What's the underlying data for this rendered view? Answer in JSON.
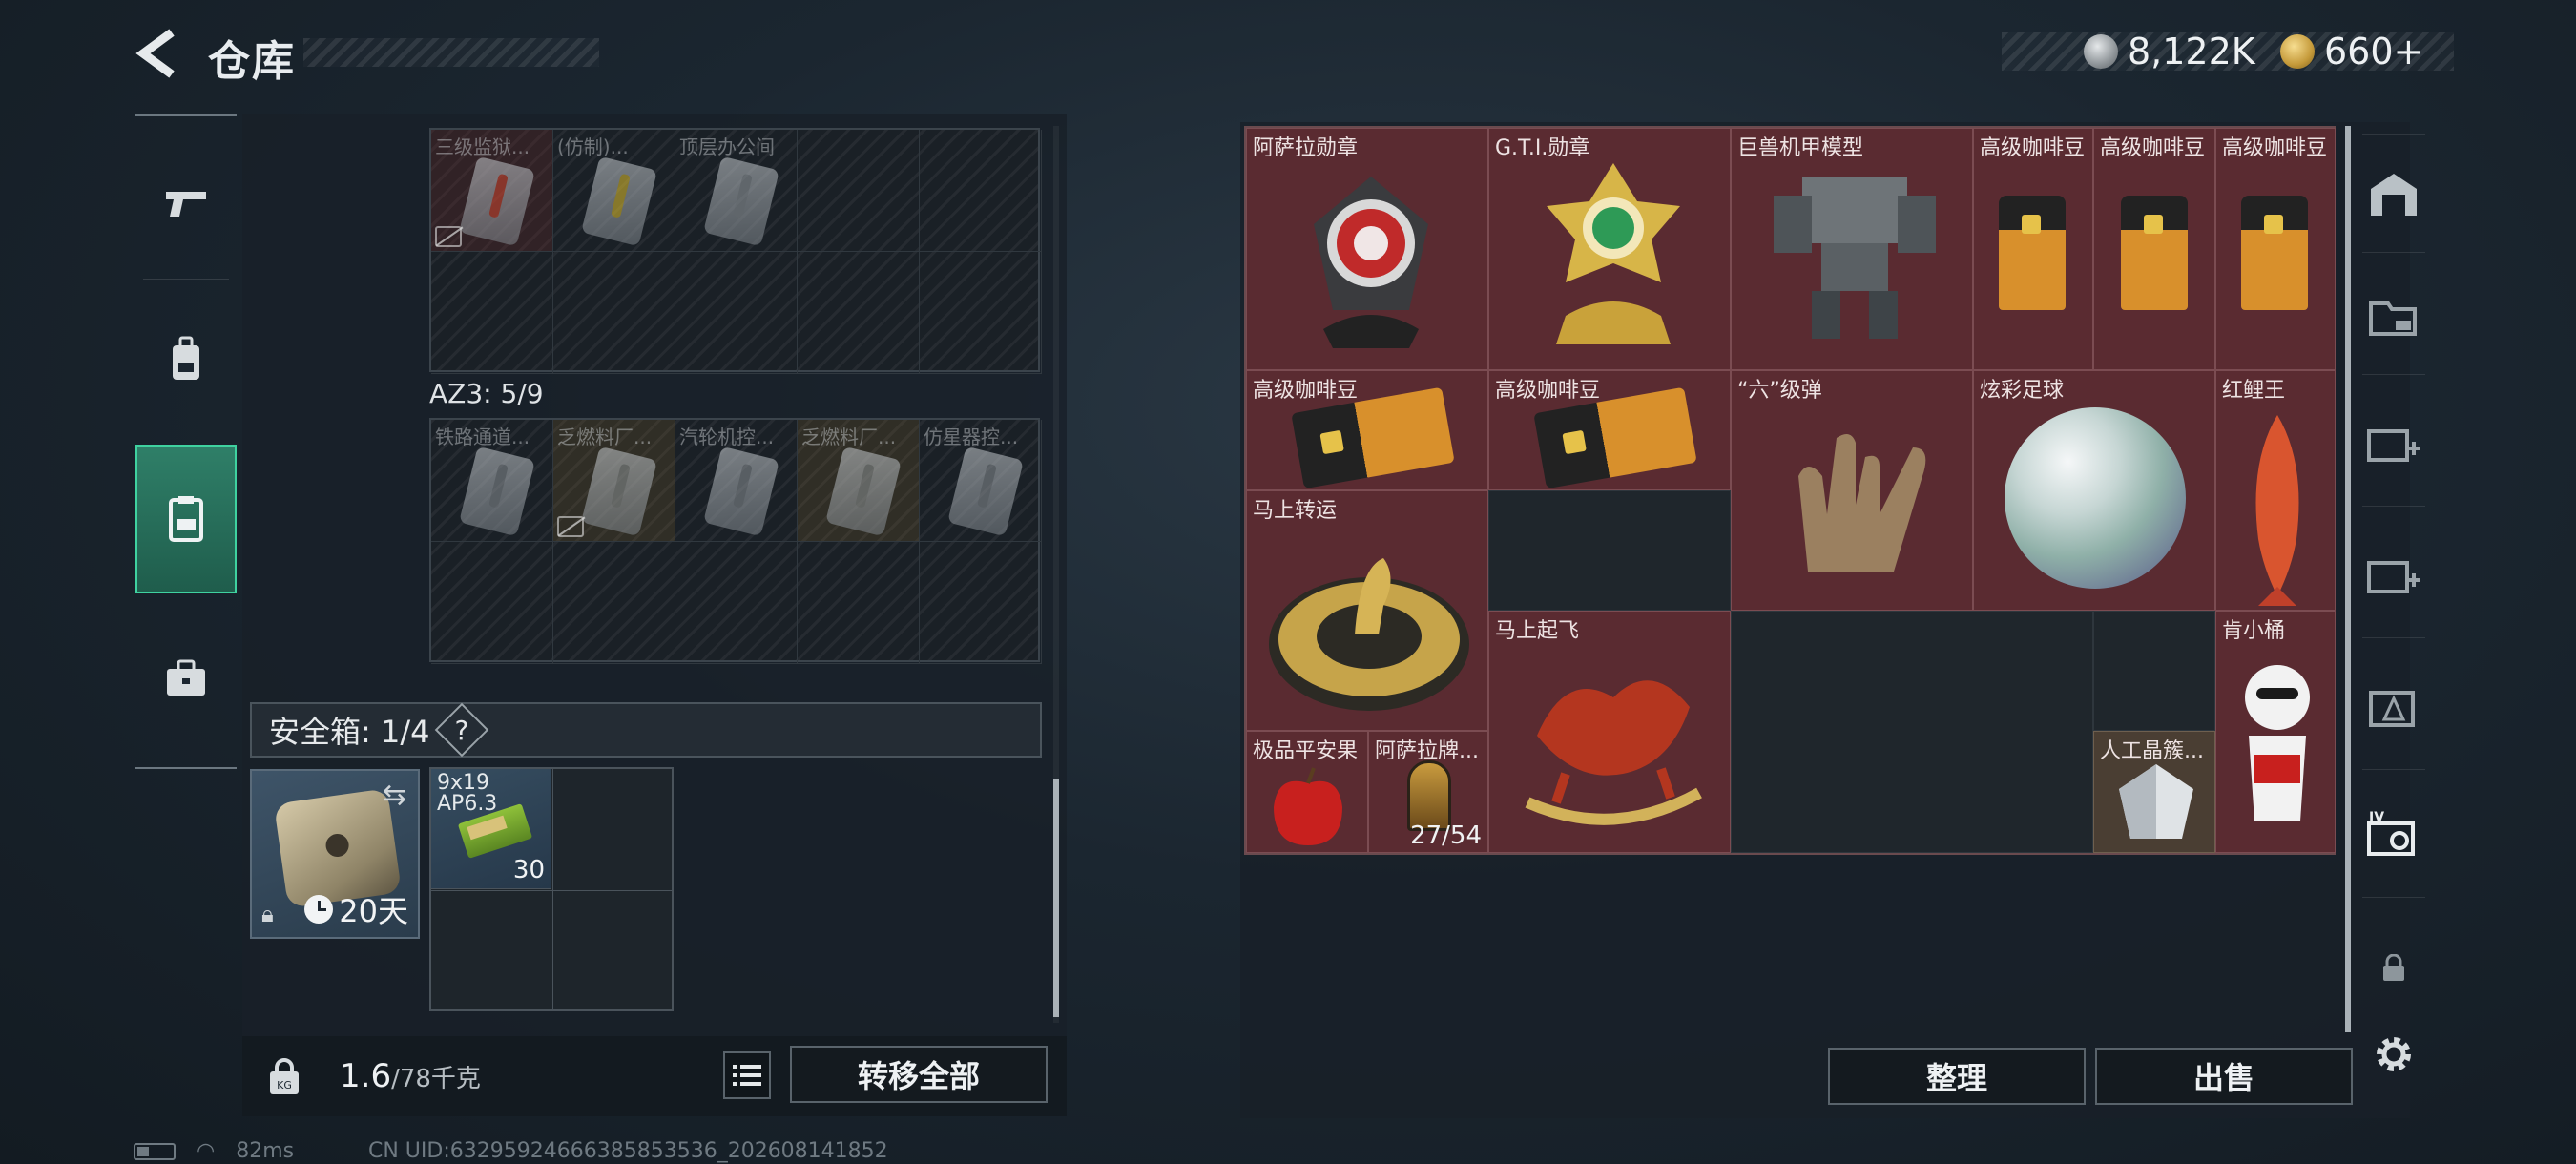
{
  "header": {
    "title": "仓库",
    "silver": "8,122K",
    "gold": "660+"
  },
  "left_nav": [
    "gun-icon",
    "backpack-icon",
    "vest-icon",
    "briefcase-icon"
  ],
  "storage_top": {
    "labels": [
      "三级监狱...",
      "(仿制)...",
      "顶层办公间"
    ]
  },
  "az3": {
    "label": "AZ3: 5/9",
    "items": [
      "铁路通道...",
      "乏燃料厂...",
      "汽轮机控...",
      "乏燃料厂...",
      "仿星器控..."
    ]
  },
  "safebox": {
    "label": "安全箱: 1/4",
    "help": "?",
    "days": "20天"
  },
  "ammo": {
    "name": "9x19\nAP6.3",
    "count": "30"
  },
  "weight": {
    "current": "1.6",
    "max": "/78千克"
  },
  "buttons": {
    "transfer_all": "转移全部",
    "sort": "整理",
    "sell": "出售"
  },
  "stash_items": {
    "asala_medal": "阿萨拉勋章",
    "gti_medal": "G.T.I.勋章",
    "mech_model": "巨兽机甲模型",
    "coffee": "高级咖啡豆",
    "six_bullet": "“六”级弹",
    "football": "炫彩足球",
    "red_carp": "红鲤王",
    "horse_fortune": "马上转运",
    "horse_fly": "马上起飞",
    "kfc": "肯小桶",
    "apple": "极品平安果",
    "asala_card": "阿萨拉牌...",
    "asala_card_count": "27/54",
    "crystal": "人工晶簇..."
  },
  "status": {
    "ping": "82ms",
    "uid": "CN UID:6329592466638585353​6_202608141852"
  }
}
